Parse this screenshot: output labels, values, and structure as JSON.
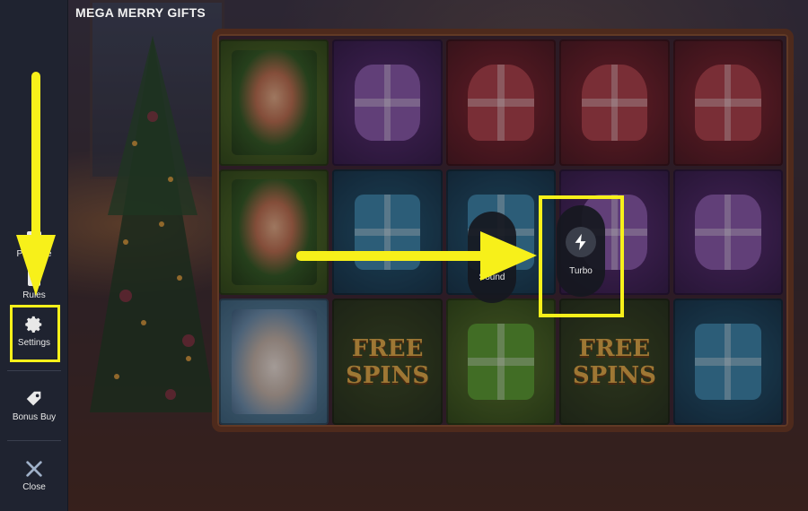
{
  "game": {
    "title": "MEGA MERRY GIFTS"
  },
  "sidebar": {
    "items": [
      {
        "label": "Paytable",
        "icon": "paytable-icon"
      },
      {
        "label": "Rules",
        "icon": "rules-icon"
      },
      {
        "label": "Settings",
        "icon": "gear-icon"
      },
      {
        "label": "Bonus Buy",
        "icon": "bonus-tag-icon"
      },
      {
        "label": "Close",
        "icon": "close-icon"
      }
    ]
  },
  "reels": {
    "rows": [
      [
        "elf",
        "purple-gift",
        "red-heart-gift",
        "red-heart-gift",
        "red-heart-gift"
      ],
      [
        "elf",
        "blue-gift",
        "blue-gift",
        "purple-gift",
        "purple-gift"
      ],
      [
        "reindeer",
        "free-spins",
        "green-gift",
        "free-spins",
        "blue-gift"
      ]
    ],
    "free_spins_text": "FREE SPINS"
  },
  "overlay": {
    "sound_label": "Sound",
    "turbo_label": "Turbo"
  },
  "colors": {
    "highlight": "#f7f01a",
    "sidebar_bg": "#1f2330",
    "button_bg": "#16181f"
  }
}
